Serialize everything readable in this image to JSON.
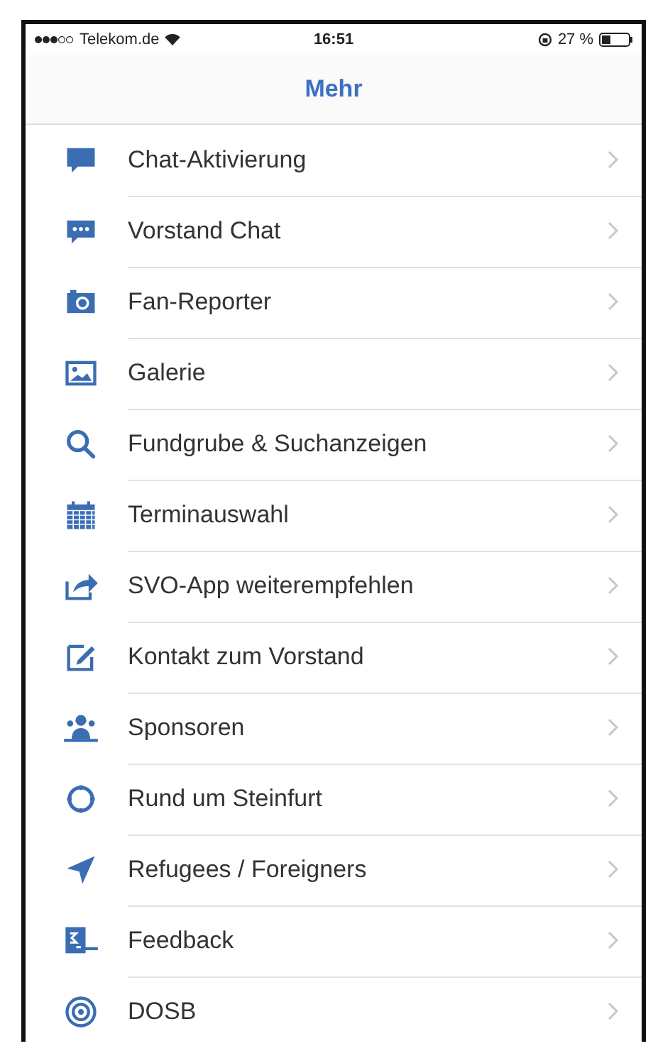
{
  "status_bar": {
    "carrier": "Telekom.de",
    "time": "16:51",
    "battery": "27 %"
  },
  "nav": {
    "title": "Mehr"
  },
  "menu": [
    {
      "label": "Chat-Aktivierung"
    },
    {
      "label": "Vorstand Chat"
    },
    {
      "label": "Fan-Reporter"
    },
    {
      "label": "Galerie"
    },
    {
      "label": "Fundgrube & Suchanzeigen"
    },
    {
      "label": "Terminauswahl"
    },
    {
      "label": "SVO-App weiterempfehlen"
    },
    {
      "label": "Kontakt zum Vorstand"
    },
    {
      "label": "Sponsoren"
    },
    {
      "label": "Rund um Steinfurt"
    },
    {
      "label": "Refugees / Foreigners"
    },
    {
      "label": "Feedback"
    },
    {
      "label": "DOSB"
    }
  ]
}
